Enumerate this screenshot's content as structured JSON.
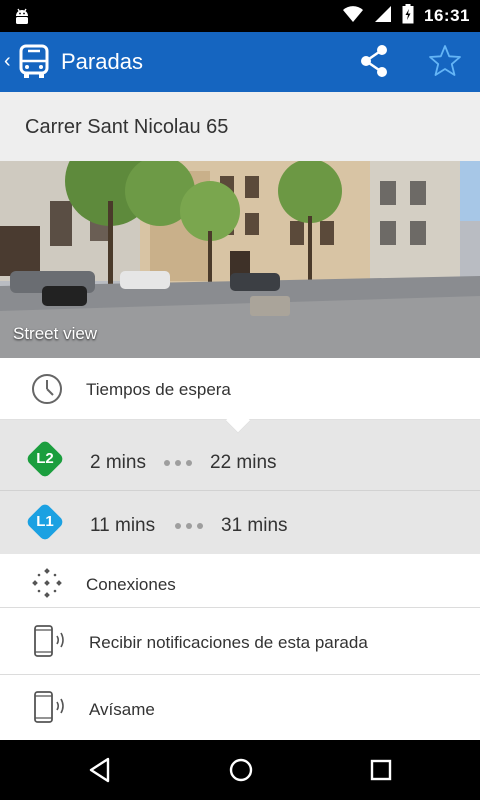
{
  "status_bar": {
    "time": "16:31"
  },
  "app_bar": {
    "back_glyph": "‹",
    "title": "Paradas"
  },
  "stop": {
    "address": "Carrer Sant Nicolau 65"
  },
  "street_view": {
    "label": "Street view"
  },
  "wait_times": {
    "label": "Tiempos de espera",
    "lines": [
      {
        "code": "L2",
        "color": "#1b9e3e",
        "next": "2 mins",
        "following": "22 mins"
      },
      {
        "code": "L1",
        "color": "#1ba1e2",
        "next": "11 mins",
        "following": "31 mins"
      }
    ]
  },
  "actions": {
    "connections": "Conexiones",
    "notifications": "Recibir notificaciones de esta parada",
    "alert": "Avísame"
  },
  "colors": {
    "primary": "#1565c0",
    "status_bar": "#000000",
    "address_bg": "#eeeeee"
  },
  "icons": [
    "android-icon",
    "wifi-icon",
    "signal-icon",
    "battery-icon",
    "bus-icon",
    "share-icon",
    "star-icon",
    "clock-icon",
    "connections-icon",
    "phone-vibrate-icon",
    "back-nav-icon",
    "home-nav-icon",
    "recents-nav-icon"
  ]
}
